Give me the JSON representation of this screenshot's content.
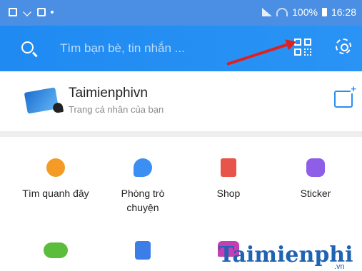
{
  "status_bar": {
    "battery": "100%",
    "time": "16:28"
  },
  "header": {
    "search_placeholder": "Tìm bạn bè, tin nhắn ..."
  },
  "profile": {
    "name": "Taimienphivn",
    "subtitle": "Trang cá nhân của bạn"
  },
  "tiles": [
    {
      "label": "Tìm quanh đây",
      "icon": "location-pin-icon"
    },
    {
      "label": "Phòng trò chuyện",
      "icon": "chat-bubble-icon"
    },
    {
      "label": "Shop",
      "icon": "shopping-bag-icon"
    },
    {
      "label": "Sticker",
      "icon": "sticker-face-icon"
    },
    {
      "label": "",
      "icon": "gamepad-icon"
    },
    {
      "label": "",
      "icon": "document-icon"
    },
    {
      "label": "",
      "icon": "building-icon"
    }
  ],
  "watermark": {
    "text": "Taimienphi",
    "sub": ".vn"
  },
  "colors": {
    "header_blue": "#2a93f5",
    "status_blue": "#4a8fe3",
    "arrow_red": "#e02020"
  }
}
